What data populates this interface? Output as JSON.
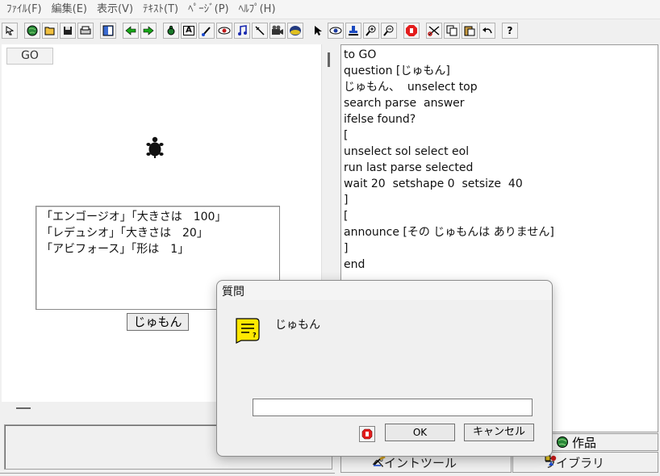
{
  "menu": [
    "ﾌｧｲﾙ(F)",
    "編集(E)",
    "表示(V)",
    "ﾃｷｽﾄ(T)",
    "ﾍﾟｰｼﾞ(P)",
    "ﾍﾙﾌﾟ(H)"
  ],
  "toolbar": {
    "icons": [
      "select-mode-icon",
      "globe-icon",
      "open-folder-icon",
      "save-icon",
      "print-icon",
      "layout-icon",
      "arrow-left-icon",
      "arrow-right-icon",
      "turtle-icon",
      "text-a-icon",
      "paint-tool-icon",
      "eye-record-icon",
      "music-note-icon",
      "wand-icon",
      "film-camera-icon",
      "object-icon",
      "pointer-icon",
      "eye-icon",
      "stamp-icon",
      "zoom-in-icon",
      "zoom-out-icon",
      "stop-hand-icon",
      "scissors-icon",
      "copy-icon",
      "paste-icon",
      "undo-icon",
      "help-icon"
    ],
    "help_label": "?",
    "text_label": "A"
  },
  "turtle_pane": {
    "go_label": "GO",
    "list_lines": [
      "「エンゴージオ」「大きさは　100」",
      "「レデュシオ」「大きさは　20」",
      "「アビフォース」「形は　1」"
    ],
    "jumon_button": "じゅもん"
  },
  "editor": {
    "lines": [
      "to GO",
      "question [じゅもん]",
      "じゅもん、  unselect top",
      "search parse  answer",
      "ifelse found?",
      "[",
      "unselect sol select eol",
      "run last parse selected",
      "wait 20  setshape 0  setsize  40",
      "]",
      "[",
      "announce [その じゅもんは ありません]",
      "]",
      "end"
    ]
  },
  "tabs": {
    "sakuhin": "作品",
    "paint": "ペイントツール",
    "library": "ライブラリ"
  },
  "dialog": {
    "title": "質問",
    "prompt": "じゅもん",
    "input_value": "",
    "ok": "OK",
    "cancel": "キャンセル"
  },
  "colors": {
    "note_icon": "#ffe800",
    "stop_icon": "#e31c1c",
    "arrow_green": "#18a818"
  }
}
